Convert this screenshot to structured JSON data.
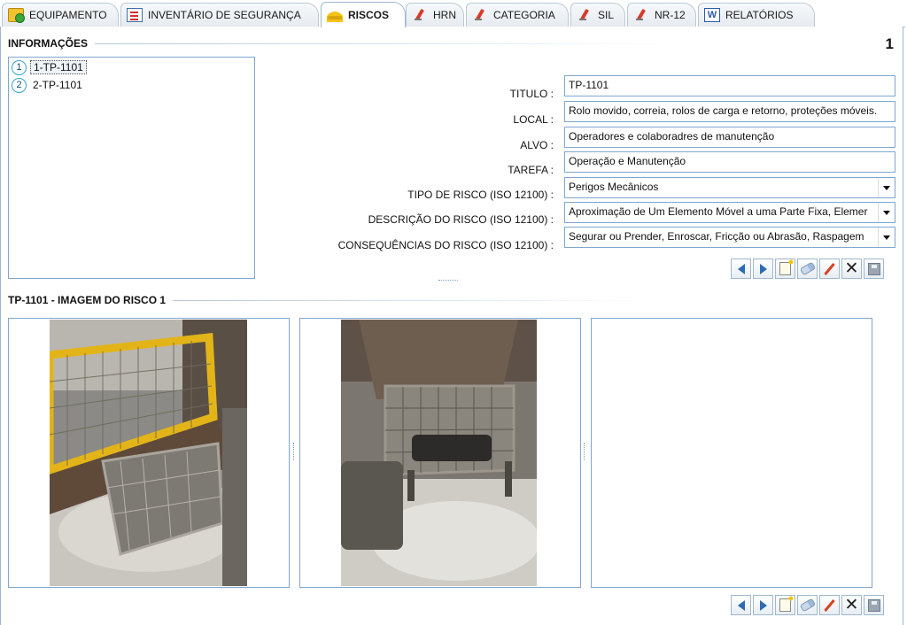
{
  "tabs": [
    {
      "label": "EQUIPAMENTO",
      "icon": "equipment-icon",
      "active": false
    },
    {
      "label": "INVENTÁRIO DE SEGURANÇA",
      "icon": "checklist-icon",
      "active": false
    },
    {
      "label": "RISCOS",
      "icon": "helmet-icon",
      "active": true
    },
    {
      "label": "HRN",
      "icon": "pen-icon",
      "active": false
    },
    {
      "label": "CATEGORIA",
      "icon": "pen-icon",
      "active": false
    },
    {
      "label": "SIL",
      "icon": "pen-icon",
      "active": false
    },
    {
      "label": "NR-12",
      "icon": "pen-icon",
      "active": false
    },
    {
      "label": "RELATÓRIOS",
      "icon": "word-icon",
      "active": false
    }
  ],
  "info": {
    "title": "INFORMAÇÕES",
    "record_count": "1",
    "list": [
      {
        "number": "1",
        "label": "1-TP-1101",
        "selected": true
      },
      {
        "number": "2",
        "label": "2-TP-1101",
        "selected": false
      }
    ]
  },
  "form": {
    "titulo": {
      "label": "TITULO :",
      "value": "TP-1101"
    },
    "local": {
      "label": "LOCAL :",
      "value": "Rolo movido, correia, rolos de carga e retorno, proteções móveis."
    },
    "alvo": {
      "label": "ALVO :",
      "value": "Operadores e colaboradres de manutenção"
    },
    "tarefa": {
      "label": "TAREFA :",
      "value": "Operação e Manutenção"
    },
    "tipo_risco": {
      "label": "TIPO DE RISCO (ISO 12100) :",
      "value": "Perigos Mecânicos"
    },
    "descricao_risco": {
      "label": "DESCRIÇÃO DO RISCO (ISO 12100) :",
      "value": "Aproximação de Um Elemento Móvel a uma Parte Fixa, Elemer"
    },
    "consequencias_risco": {
      "label": "CONSEQUÊNCIAS DO RISCO (ISO 12100) :",
      "value": "Segurar ou Prender, Enroscar, Fricção ou Abrasão, Raspagem"
    }
  },
  "images": {
    "title": "TP-1101 - IMAGEM DO RISCO 1"
  },
  "colors": {
    "border_blue": "#7fa6cf",
    "tab_border": "#9fb7cc",
    "nav_arrow": "#2c6bb3"
  }
}
